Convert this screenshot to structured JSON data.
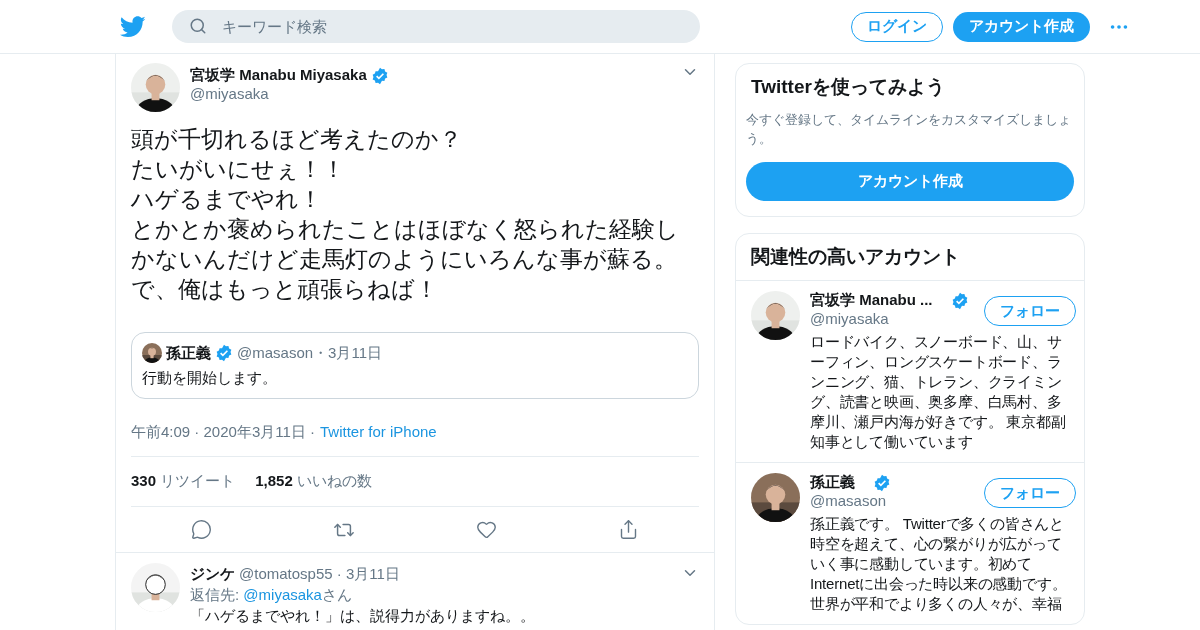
{
  "header": {
    "search": {
      "placeholder": "キーワード検索"
    },
    "login": "ログイン",
    "signup": "アカウント作成"
  },
  "tweet": {
    "name": "宮坂学 Manabu Miyasaka",
    "verified": true,
    "handle": "@miyasaka",
    "text_lines": [
      "頭が千切れるほど考えたのか？",
      "たいがいにせぇ！！",
      "ハゲるまでやれ！",
      "とかとか褒められたことはほぼなく怒られた経験しかないんだけど走馬灯のようにいろんな事が蘇る。",
      "で、俺はもっと頑張らねば！"
    ],
    "quoted": {
      "name": "孫正義",
      "verified": true,
      "meta": "@masason・3月11日",
      "text": "行動を開始します。"
    },
    "timestamp": "午前4:09 · 2020年3月11日 ·",
    "source": "Twitter for iPhone",
    "stats": [
      {
        "count": "330",
        "label": "リツイート"
      },
      {
        "count": "1,852",
        "label": "いいねの数"
      }
    ]
  },
  "reply": {
    "name": "ジンケ",
    "meta": "@tomatosp55 · 3月11日",
    "reply_label": "返信先:",
    "reply_to": "@miyasaka",
    "reply_suffix": "さん",
    "text": "「ハゲるまでやれ！」は、説得力がありますね。。"
  },
  "sidebar": {
    "signup_card": {
      "title": "Twitterを使ってみよう",
      "text": "今すぐ登録して、タイムラインをカスタマイズしましょう。",
      "button": "アカウント作成"
    },
    "related": {
      "title": "関連性の高いアカウント",
      "accounts": [
        {
          "name": "宮坂学 Manabu ...",
          "verified": true,
          "handle": "@miyasaka",
          "follow": "フォロー",
          "bio": "ロードバイク、スノーボード、山、サーフィン、ロングスケートボード、ランニング、猫、トレラン、クライミング、読書と映画、奥多摩、白馬村、多摩川、瀬戸内海が好きです。 東京都副知事として働いています"
        },
        {
          "name": "孫正義",
          "verified": true,
          "handle": "@masason",
          "follow": "フォロー",
          "bio": "孫正義です。 Twitterで多くの皆さんと時空を超えて、心の繋がりが広がっていく事に感動しています。初めてInternetに出会った時以来の感動です。世界が平和でより多くの人々が、幸福"
        }
      ]
    }
  }
}
